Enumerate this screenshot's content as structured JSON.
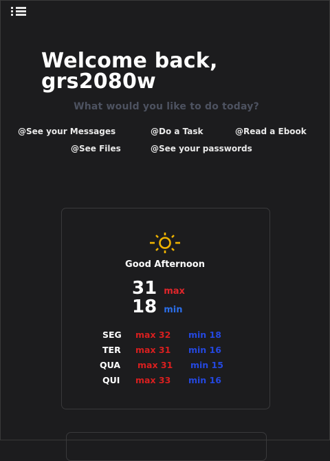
{
  "header": {
    "welcome_line1": "Welcome back,",
    "welcome_line2": "grs2080w",
    "subtitle": "What would you like to do today?"
  },
  "links": [
    {
      "label": "@See your Messages"
    },
    {
      "label": "@Do a Task"
    },
    {
      "label": "@Read a Ebook"
    },
    {
      "label": "@See Files"
    },
    {
      "label": "@See your passwords"
    }
  ],
  "weather": {
    "icon": "sun-icon",
    "greeting": "Good Afternoon",
    "current_max": "31",
    "current_max_label": "max",
    "current_min": "18",
    "current_min_label": "min",
    "forecast": [
      {
        "day": "SEG",
        "max": "max 32",
        "min": "min 18"
      },
      {
        "day": "TER",
        "max": "max 31",
        "min": "min 16"
      },
      {
        "day": "QUA",
        "max": "max 31",
        "min": "min 15"
      },
      {
        "day": "QUI",
        "max": "max 33",
        "min": "min 16"
      }
    ]
  },
  "colors": {
    "background": "#1c1c1e",
    "max": "#e0262b",
    "min": "#2b6ee8",
    "sun": "#f0b400"
  }
}
